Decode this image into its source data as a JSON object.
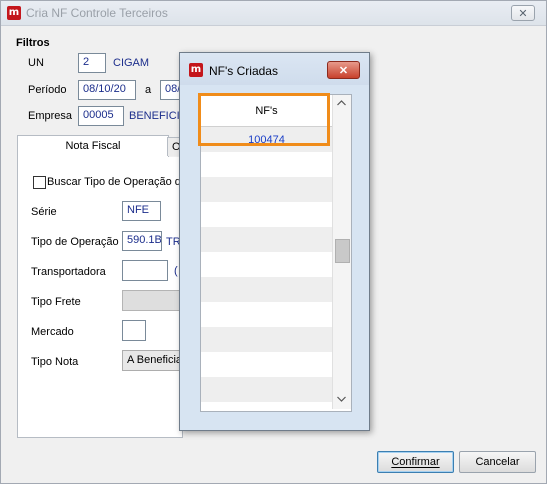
{
  "main_window": {
    "title": "Cria NF Controle Terceiros",
    "close_glyph": "✕"
  },
  "filtros": {
    "title": "Filtros",
    "un_label": "UN",
    "un_value": "2",
    "un_name": "CIGAM",
    "periodo_label": "Período",
    "periodo_start": "08/10/20",
    "periodo_sep": "a",
    "periodo_end": "08/",
    "empresa_label": "Empresa",
    "empresa_value": "00005",
    "empresa_name": "BENEFICIA"
  },
  "tabs": {
    "active": "Nota Fiscal",
    "partial": "O"
  },
  "nota_fiscal": {
    "buscar_label": "Buscar Tipo de Operação da",
    "serie_label": "Série",
    "serie_value": "NFE",
    "tipo_operacao_label": "Tipo de Operação",
    "tipo_operacao_value": "590.1B",
    "tipo_operacao_name": "TR",
    "transportadora_label": "Transportadora",
    "transportadora_value": "",
    "transportadora_partial": "(",
    "tipo_frete_label": "Tipo Frete",
    "mercado_label": "Mercado",
    "tipo_nota_label": "Tipo Nota",
    "tipo_nota_value": "A Beneficiar"
  },
  "buttons": {
    "confirmar": "Confirmar",
    "cancelar": "Cancelar"
  },
  "dialog": {
    "title": "NF's Criadas",
    "close_glyph": "✕",
    "column_header": "NF's",
    "rows": [
      "100474"
    ]
  },
  "colors": {
    "highlight": "#f08c1a",
    "link": "#1a3ec7",
    "field_text": "#1c2e8c"
  }
}
